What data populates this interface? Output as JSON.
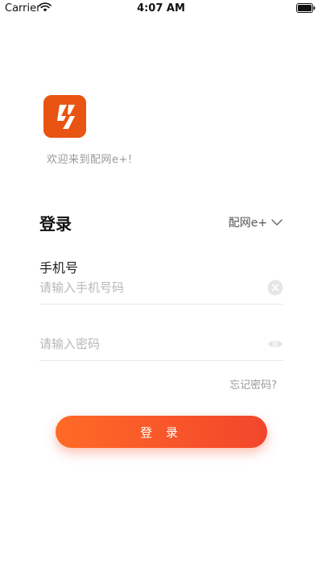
{
  "status_bar": {
    "carrier": "Carrier",
    "time": "4:07 AM"
  },
  "brand": {
    "logo_icon": "lightning-bolt-logo",
    "accent_color": "#ea5412",
    "welcome": "欢迎来到配网e+!"
  },
  "login": {
    "title": "登录",
    "network_select": {
      "value": "配网e+",
      "icon": "chevron-down-icon"
    },
    "phone": {
      "label": "手机号",
      "placeholder": "请输入手机号码",
      "value": "",
      "clear_icon": "clear-icon"
    },
    "password": {
      "placeholder": "请输入密码",
      "value": "",
      "visibility_icon": "eye-icon"
    },
    "forgot": "忘记密码?",
    "submit": "登 录",
    "button_colors": [
      "#ff6a26",
      "#f2462c"
    ]
  }
}
